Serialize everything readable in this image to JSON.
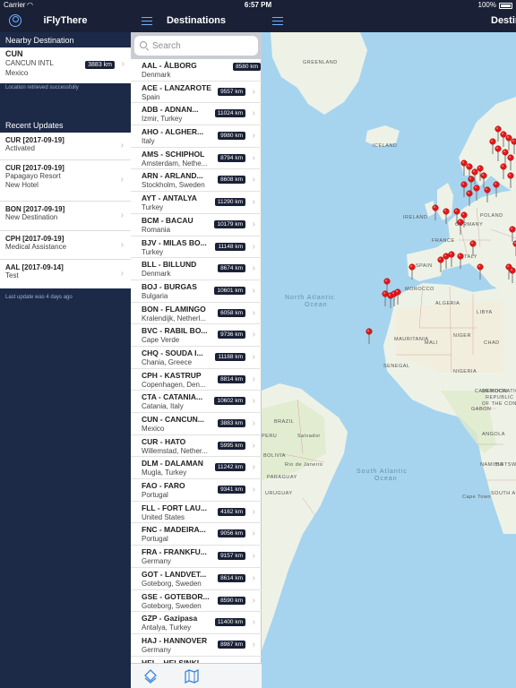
{
  "status": {
    "carrier": "Carrier",
    "time": "6:57 PM",
    "battery": "100%"
  },
  "left": {
    "title": "iFlyThere",
    "nearby_header": "Nearby Destination",
    "nearby": {
      "code": "CUN",
      "airport": "CANCUN INTL",
      "country": "Mexico",
      "km": "3883 km"
    },
    "location_status": "Location retrieved successfully",
    "updates_header": "Recent Updates",
    "updates": [
      {
        "title": "CUR [2017-09-19]",
        "lines": [
          "Activated"
        ]
      },
      {
        "title": "CUR [2017-09-19]",
        "lines": [
          "Papagayo Resort",
          "New Hotel"
        ]
      },
      {
        "title": "BON [2017-09-19]",
        "lines": [
          "New Destination"
        ]
      },
      {
        "title": "CPH [2017-09-19]",
        "lines": [
          "Medical Assistance"
        ]
      },
      {
        "title": "AAL [2017-09-14]",
        "lines": [
          "Test"
        ]
      }
    ],
    "last_update": "Last update was 4 days ago"
  },
  "middle": {
    "title": "Destinations",
    "search_placeholder": "Search",
    "destinations": [
      {
        "name": "AAL - ÅLBORG",
        "country": "Denmark",
        "km": "8580 km"
      },
      {
        "name": "ACE - LANZAROTE",
        "country": "Spain",
        "km": "9557 km"
      },
      {
        "name": "ADB - ADNAN...",
        "country": "Izmir, Turkey",
        "km": "11024 km"
      },
      {
        "name": "AHO - ALGHER...",
        "country": "Italy",
        "km": "9980 km"
      },
      {
        "name": "AMS - SCHIPHOL",
        "country": "Amsterdam, Nethe...",
        "km": "8794 km"
      },
      {
        "name": "ARN - ARLAND...",
        "country": "Stockholm, Sweden",
        "km": "8608 km"
      },
      {
        "name": "AYT - ANTALYA",
        "country": "Turkey",
        "km": "11290 km"
      },
      {
        "name": "BCM - BACAU",
        "country": "Romania",
        "km": "10179 km"
      },
      {
        "name": "BJV - MILAS BO...",
        "country": "Turkey",
        "km": "11148 km"
      },
      {
        "name": "BLL - BILLUND",
        "country": "Denmark",
        "km": "8674 km"
      },
      {
        "name": "BOJ - BURGAS",
        "country": "Bulgaria",
        "km": "10601 km"
      },
      {
        "name": "BON - FLAMINGO",
        "country": "Kralendijk, Netherl...",
        "km": "6058 km"
      },
      {
        "name": "BVC - RABIL BO...",
        "country": "Cape Verde",
        "km": "9736 km"
      },
      {
        "name": "CHQ - SOUDA I...",
        "country": "Chania, Greece",
        "km": "11188 km"
      },
      {
        "name": "CPH - KASTRUP",
        "country": "Copenhagen, Den...",
        "km": "8814 km"
      },
      {
        "name": "CTA - CATANIA...",
        "country": "Catania, Italy",
        "km": "10602 km"
      },
      {
        "name": "CUN - CANCUN...",
        "country": "Mexico",
        "km": "3883 km"
      },
      {
        "name": "CUR - HATO",
        "country": "Willemstad, Nether...",
        "km": "5995 km"
      },
      {
        "name": "DLM - DALAMAN",
        "country": "Mugla, Turkey",
        "km": "11242 km"
      },
      {
        "name": "FAO - FARO",
        "country": "Portugal",
        "km": "9341 km"
      },
      {
        "name": "FLL - FORT LAU...",
        "country": "United States",
        "km": "4162 km"
      },
      {
        "name": "FNC - MADEIRA...",
        "country": "Portugal",
        "km": "9056 km"
      },
      {
        "name": "FRA - FRANKFU...",
        "country": "Germany",
        "km": "9157 km"
      },
      {
        "name": "GOT - LANDVET...",
        "country": "Goteborg, Sweden",
        "km": "8614 km"
      },
      {
        "name": "GSE - GOTEBOR...",
        "country": "Goteborg, Sweden",
        "km": "8590 km"
      },
      {
        "name": "GZP - Gazipasa",
        "country": "Antalya, Turkey",
        "km": "11400 km"
      },
      {
        "name": "HAJ - HANNOVER",
        "country": "Germany",
        "km": "8987 km"
      },
      {
        "name": "HEL - HELSINKI",
        "country": "",
        "km": ""
      }
    ]
  },
  "right": {
    "title": "Destinations"
  },
  "map": {
    "labels": {
      "greenland": "GREENLAND",
      "iceland": "ICELAND",
      "ireland": "IRELAND",
      "germany": "GERMANY",
      "poland": "POLAND",
      "france": "FRANCE",
      "spain": "SPAIN",
      "italy": "ITALY",
      "morocco": "MOROCCO",
      "algeria": "ALGERIA",
      "libya": "LIBYA",
      "mauritania": "MAURITANIA",
      "mali": "MALI",
      "niger": "NIGER",
      "chad": "CHAD",
      "senegal": "SENEGAL",
      "nigeria": "NIGERIA",
      "cameroon": "CAMEROON",
      "gabon": "GABON",
      "dr_congo": "DEMOCRATIC",
      "republic": "REPUBLIC",
      "of_the_congo": "OF THE CONGO",
      "angola": "ANGOLA",
      "namibia": "NAMIBIA",
      "botswana": "BOTSWANA",
      "south_africa": "SOUTH AFRICA",
      "brazil": "BRAZIL",
      "peru": "PERU",
      "bolivia": "BOLIVIA",
      "paraguay": "PARAGUAY",
      "uruguay": "URUGUAY",
      "salvador": "Salvador",
      "rio": "Rio de Janeiro",
      "cape_town": "Cape Town",
      "north_atlantic_1": "North Atlantic",
      "north_atlantic_2": "Ocean",
      "south_atlantic_1": "South Atlantic",
      "south_atlantic_2": "Ocean"
    }
  }
}
